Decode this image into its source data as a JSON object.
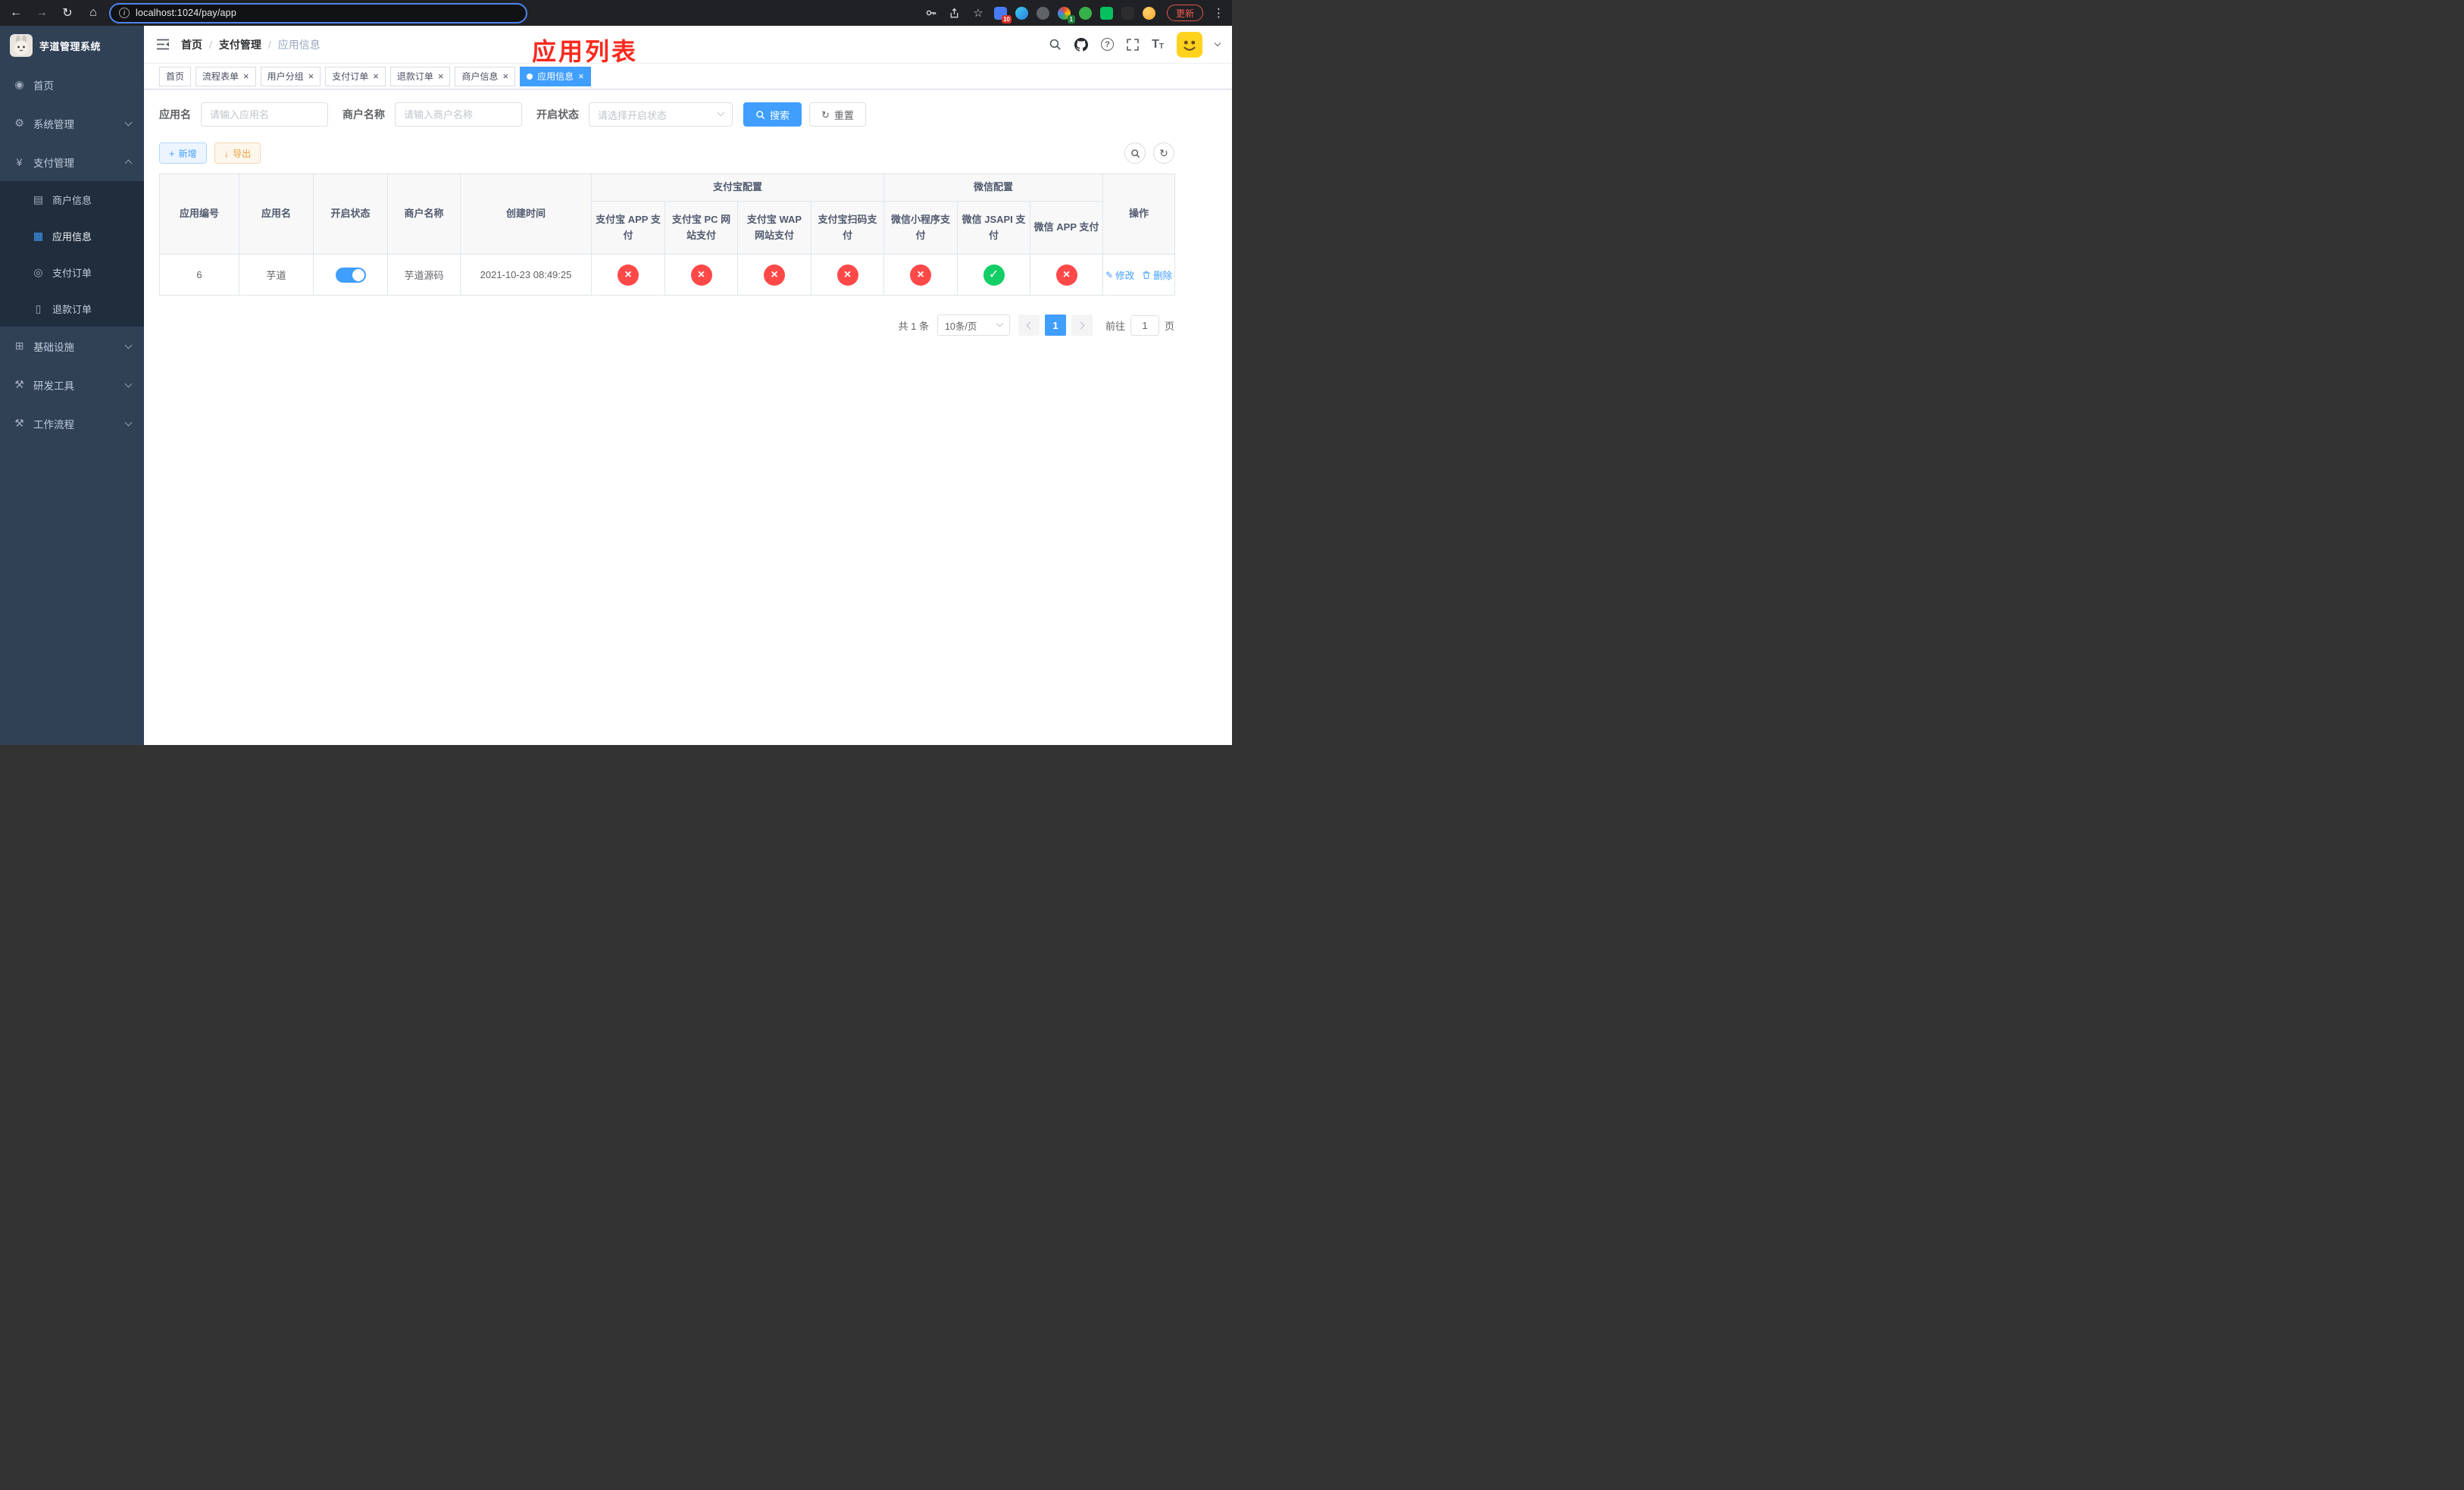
{
  "browser": {
    "url": "localhost:1024/pay/app",
    "update_label": "更新",
    "ext_badge_10": "10",
    "ext_badge_1": "1"
  },
  "icons": {
    "back": "←",
    "forward": "→",
    "reload": "↻",
    "home": "⌂",
    "star": "☆",
    "more": "⋮",
    "info": "i",
    "close": "×",
    "check": "✓",
    "cross": "×",
    "plus": "+",
    "download": "↓",
    "edit": "✎",
    "question": "?",
    "font_size": "T",
    "menu_home": "◉",
    "menu_system": "⚙",
    "menu_pay": "¥",
    "menu_merchant": "▤",
    "menu_app": "▦",
    "menu_order": "◎",
    "menu_refund": "▯",
    "menu_infra": "⊞",
    "menu_tools": "⚒",
    "menu_workflow": "⚒"
  },
  "sidebar": {
    "title": "芋道管理系统",
    "items": [
      {
        "label": "首页"
      },
      {
        "label": "系统管理"
      },
      {
        "label": "支付管理",
        "children": [
          {
            "label": "商户信息"
          },
          {
            "label": "应用信息"
          },
          {
            "label": "支付订单"
          },
          {
            "label": "退款订单"
          }
        ]
      },
      {
        "label": "基础设施"
      },
      {
        "label": "研发工具"
      },
      {
        "label": "工作流程"
      }
    ]
  },
  "header": {
    "breadcrumb": [
      "首页",
      "支付管理",
      "应用信息"
    ],
    "separator": "/",
    "annotation": "应用列表"
  },
  "tabs": [
    {
      "label": "首页"
    },
    {
      "label": "流程表单"
    },
    {
      "label": "用户分组"
    },
    {
      "label": "支付订单"
    },
    {
      "label": "退款订单"
    },
    {
      "label": "商户信息"
    },
    {
      "label": "应用信息"
    }
  ],
  "filters": {
    "app_name": {
      "label": "应用名",
      "placeholder": "请输入应用名"
    },
    "merchant": {
      "label": "商户名称",
      "placeholder": "请输入商户名称"
    },
    "status": {
      "label": "开启状态",
      "placeholder": "请选择开启状态"
    },
    "search": "搜索",
    "reset": "重置"
  },
  "toolbar": {
    "add": "新增",
    "export": "导出"
  },
  "table": {
    "groups": {
      "alipay": "支付宝配置",
      "wechat": "微信配置"
    },
    "columns": [
      "应用编号",
      "应用名",
      "开启状态",
      "商户名称",
      "创建时间",
      "支付宝 APP 支付",
      "支付宝 PC 网站支付",
      "支付宝 WAP 网站支付",
      "支付宝扫码支付",
      "微信小程序支付",
      "微信 JSAPI 支付",
      "微信 APP 支付",
      "操作"
    ],
    "actions": {
      "edit": "修改",
      "delete": "删除"
    },
    "rows": [
      {
        "id": "6",
        "name": "芋道",
        "enabled": true,
        "merchant": "芋道源码",
        "created": "2021-10-23 08:49:25",
        "configs": [
          "no",
          "no",
          "no",
          "no",
          "no",
          "yes",
          "no"
        ]
      }
    ]
  },
  "pagination": {
    "total": "共 1 条",
    "page_size": "10条/页",
    "page": "1",
    "goto": "前往",
    "goto_value": "1",
    "unit": "页"
  }
}
